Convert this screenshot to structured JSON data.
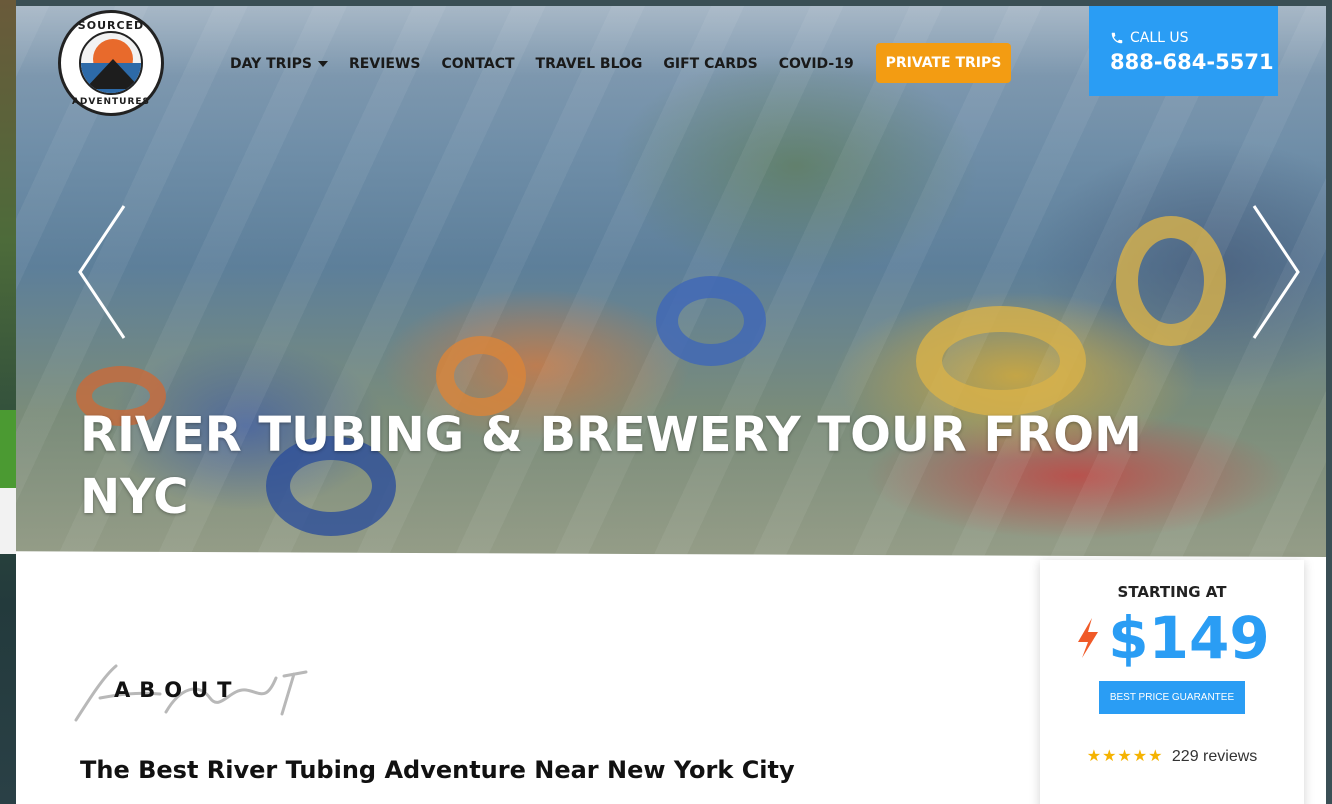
{
  "brand": {
    "logo_top": "SOURCED",
    "logo_bottom": "ADVENTURES"
  },
  "nav": {
    "items": [
      {
        "label": "DAY TRIPS",
        "has_dropdown": true
      },
      {
        "label": "REVIEWS"
      },
      {
        "label": "CONTACT"
      },
      {
        "label": "TRAVEL BLOG"
      },
      {
        "label": "GIFT CARDS"
      },
      {
        "label": "COVID-19"
      }
    ],
    "private_trips": "PRIVATE TRIPS",
    "private_trips_color": "#f39c12"
  },
  "call": {
    "label": "CALL US",
    "number": "888-684-5571",
    "icon": "phone-icon",
    "color": "#2a9df4"
  },
  "hero": {
    "title": "RIVER TUBING & BREWERY TOUR FROM NYC",
    "prev_icon": "chevron-left-icon",
    "next_icon": "chevron-right-icon"
  },
  "price_card": {
    "starting_at": "STARTING AT",
    "price": "$149",
    "guarantee": "BEST PRICE GUARANTEE",
    "stars": "★★★★★",
    "reviews": "229 reviews",
    "accent": "#2a9df4",
    "bolt_color": "#f05a28"
  },
  "about": {
    "label": "ABOUT",
    "heading": "The Best River Tubing Adventure Near New York City"
  }
}
